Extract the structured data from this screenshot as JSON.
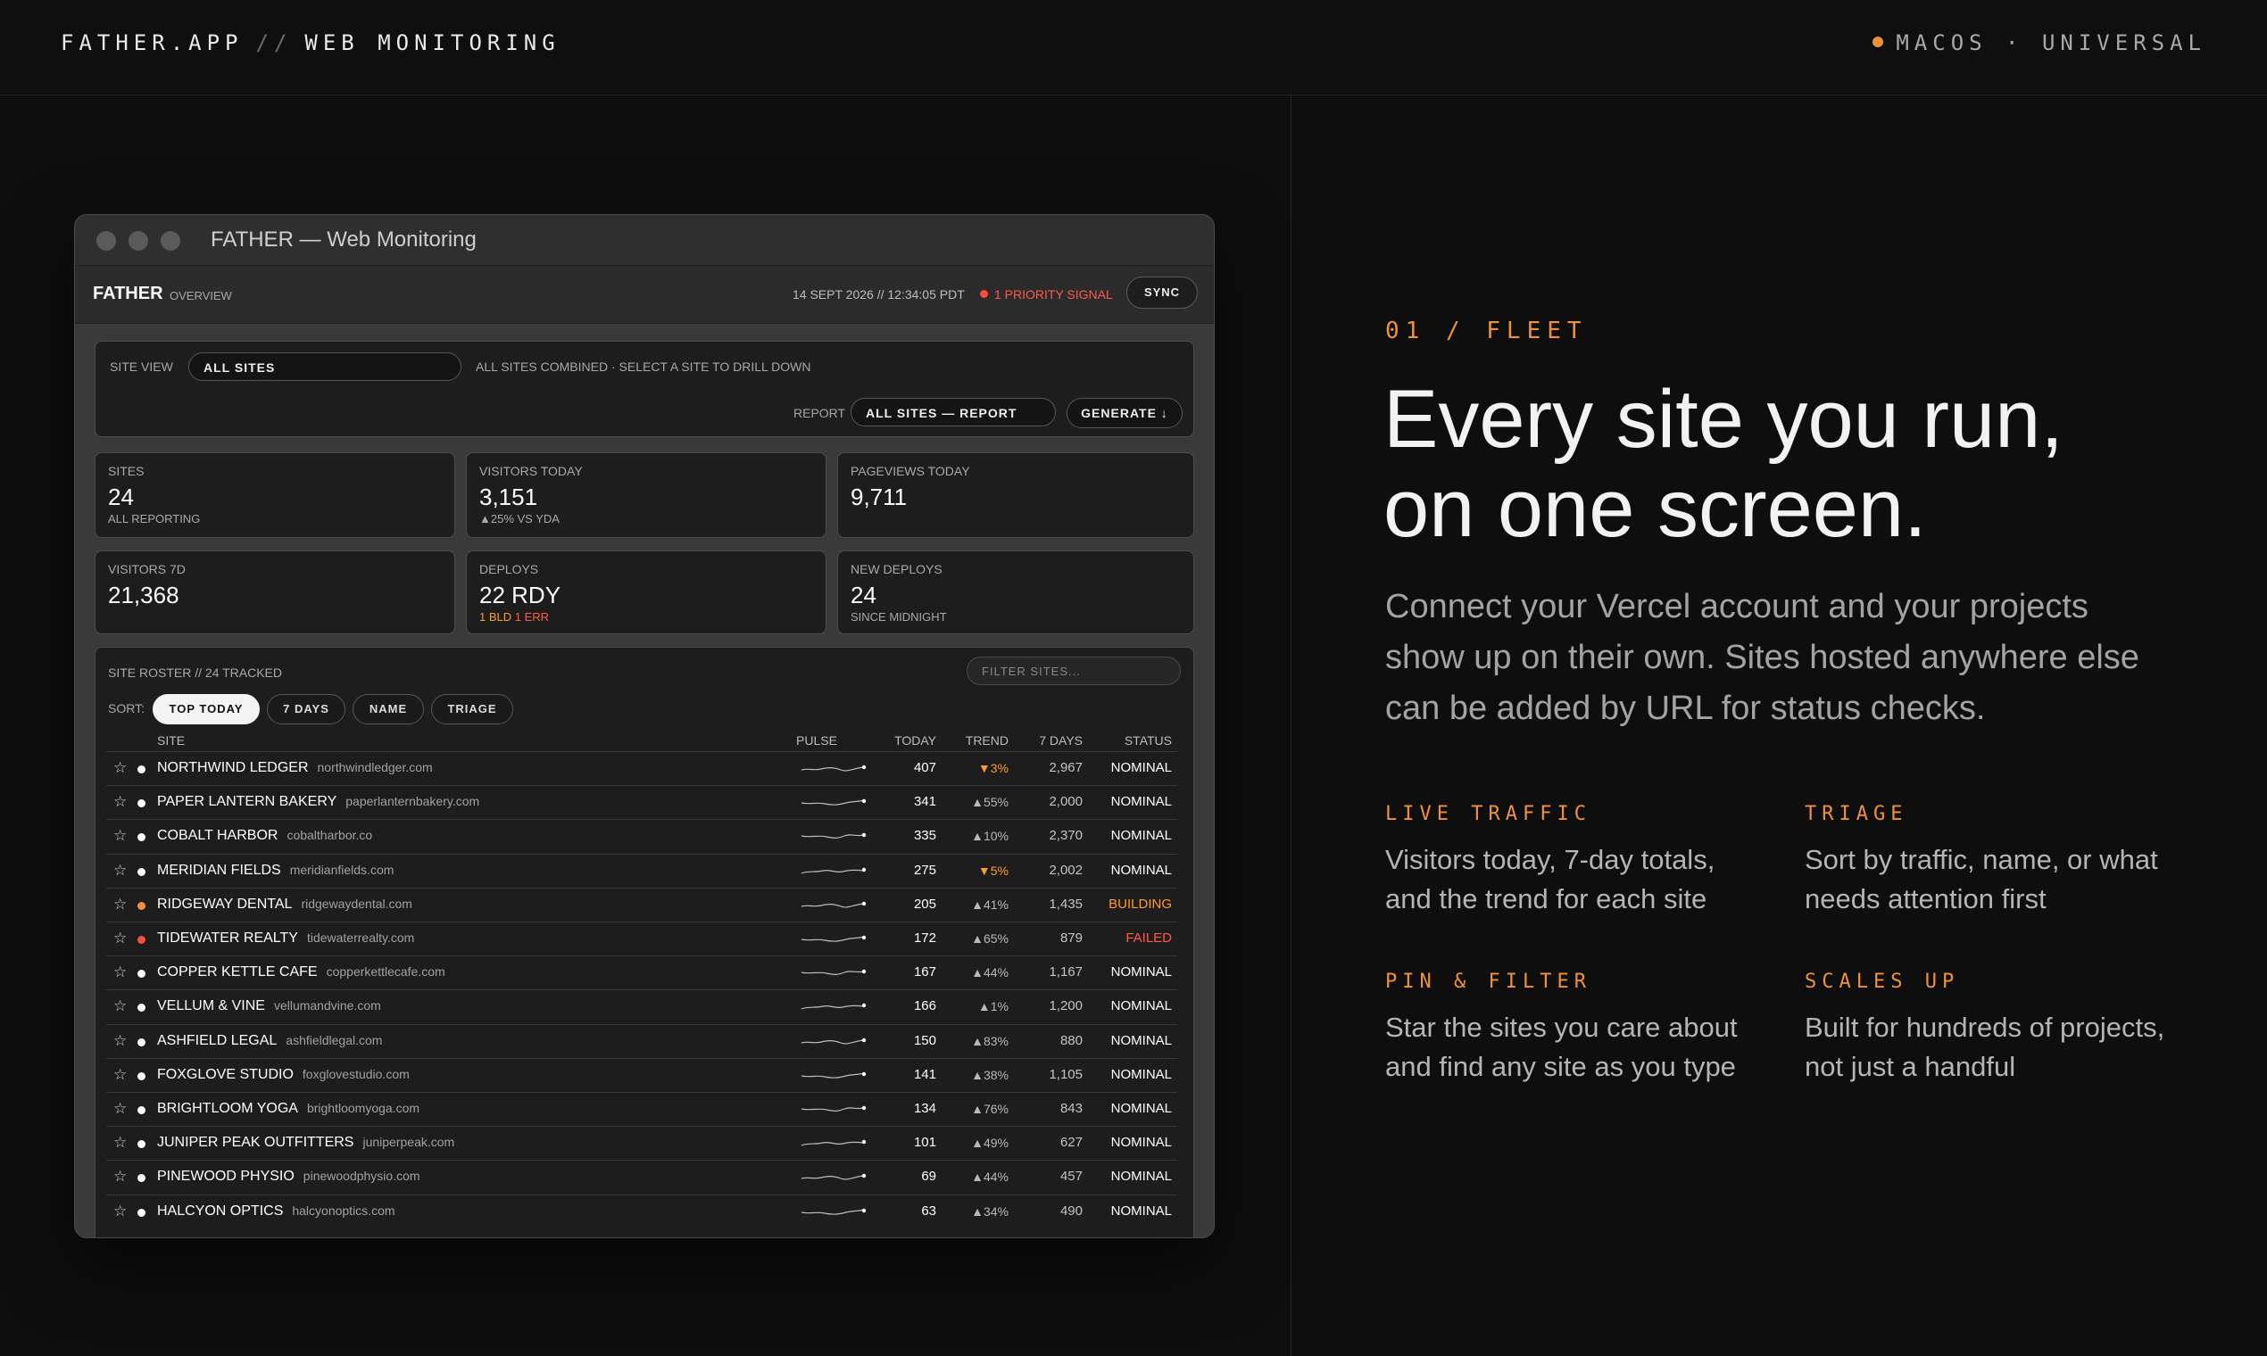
{
  "header": {
    "brand": "FATHER.APP",
    "brand_sep": "//",
    "brand_sub": "WEB MONITORING",
    "platform": "MACOS · UNIVERSAL"
  },
  "window": {
    "title": "FATHER — Web Monitoring",
    "app_name": "FATHER",
    "app_section": "OVERVIEW",
    "timestamp": "14 SEPT 2026 // 12:34:05 PDT",
    "priority_signal": "1 PRIORITY SIGNAL",
    "sync_label": "SYNC",
    "site_view": {
      "label": "SITE VIEW",
      "selected": "ALL SITES",
      "hint": "ALL SITES COMBINED · SELECT A SITE TO DRILL DOWN"
    },
    "report": {
      "label": "REPORT",
      "selected": "ALL SITES — REPORT",
      "generate_label": "GENERATE ↓"
    },
    "kpis": [
      {
        "label": "SITES",
        "value": "24",
        "sub": "ALL REPORTING"
      },
      {
        "label": "VISITORS TODAY",
        "value": "3,151",
        "sub": "▲25% VS YDA"
      },
      {
        "label": "PAGEVIEWS TODAY",
        "value": "9,711",
        "sub": ""
      },
      {
        "label": "VISITORS 7D",
        "value": "21,368",
        "sub": ""
      },
      {
        "label": "DEPLOYS",
        "value": "22 RDY",
        "sub_bld": "1 BLD",
        "sub_err": "1 ERR"
      },
      {
        "label": "NEW DEPLOYS",
        "value": "24",
        "sub": "SINCE MIDNIGHT"
      }
    ],
    "roster": {
      "title": "SITE ROSTER // 24 TRACKED",
      "filter_placeholder": "FILTER SITES...",
      "sort_label": "SORT:",
      "sort_options": [
        "TOP TODAY",
        "7 DAYS",
        "NAME",
        "TRIAGE"
      ],
      "active_sort": "TOP TODAY",
      "columns": {
        "site": "SITE",
        "pulse": "PULSE",
        "today": "TODAY",
        "trend": "TREND",
        "seven_days": "7 DAYS",
        "status": "STATUS"
      },
      "rows": [
        {
          "name": "NORTHWIND LEDGER",
          "domain": "northwindledger.com",
          "today": "407",
          "trend": "▼3%",
          "trend_dir": "down",
          "seven_days": "2,967",
          "status": "NOMINAL",
          "dot": "#ffffff",
          "status_color": "#ffffff"
        },
        {
          "name": "PAPER LANTERN BAKERY",
          "domain": "paperlanternbakery.com",
          "today": "341",
          "trend": "▲55%",
          "trend_dir": "up",
          "seven_days": "2,000",
          "status": "NOMINAL",
          "dot": "#ffffff",
          "status_color": "#ffffff"
        },
        {
          "name": "COBALT HARBOR",
          "domain": "cobaltharbor.co",
          "today": "335",
          "trend": "▲10%",
          "trend_dir": "up",
          "seven_days": "2,370",
          "status": "NOMINAL",
          "dot": "#ffffff",
          "status_color": "#ffffff"
        },
        {
          "name": "MERIDIAN FIELDS",
          "domain": "meridianfields.com",
          "today": "275",
          "trend": "▼5%",
          "trend_dir": "down",
          "seven_days": "2,002",
          "status": "NOMINAL",
          "dot": "#ffffff",
          "status_color": "#ffffff"
        },
        {
          "name": "RIDGEWAY DENTAL",
          "domain": "ridgewaydental.com",
          "today": "205",
          "trend": "▲41%",
          "trend_dir": "up",
          "seven_days": "1,435",
          "status": "BUILDING",
          "dot": "#f0913a",
          "status_color": "#ff9a2f"
        },
        {
          "name": "TIDEWATER REALTY",
          "domain": "tidewaterrealty.com",
          "today": "172",
          "trend": "▲65%",
          "trend_dir": "up",
          "seven_days": "879",
          "status": "FAILED",
          "dot": "#ff4b3a",
          "status_color": "#ff5a47"
        },
        {
          "name": "COPPER KETTLE CAFE",
          "domain": "copperkettlecafe.com",
          "today": "167",
          "trend": "▲44%",
          "trend_dir": "up",
          "seven_days": "1,167",
          "status": "NOMINAL",
          "dot": "#ffffff",
          "status_color": "#ffffff"
        },
        {
          "name": "VELLUM & VINE",
          "domain": "vellumandvine.com",
          "today": "166",
          "trend": "▲1%",
          "trend_dir": "up",
          "seven_days": "1,200",
          "status": "NOMINAL",
          "dot": "#ffffff",
          "status_color": "#ffffff"
        },
        {
          "name": "ASHFIELD LEGAL",
          "domain": "ashfieldlegal.com",
          "today": "150",
          "trend": "▲83%",
          "trend_dir": "up",
          "seven_days": "880",
          "status": "NOMINAL",
          "dot": "#ffffff",
          "status_color": "#ffffff"
        },
        {
          "name": "FOXGLOVE STUDIO",
          "domain": "foxglovestudio.com",
          "today": "141",
          "trend": "▲38%",
          "trend_dir": "up",
          "seven_days": "1,105",
          "status": "NOMINAL",
          "dot": "#ffffff",
          "status_color": "#ffffff"
        },
        {
          "name": "BRIGHTLOOM YOGA",
          "domain": "brightloomyoga.com",
          "today": "134",
          "trend": "▲76%",
          "trend_dir": "up",
          "seven_days": "843",
          "status": "NOMINAL",
          "dot": "#ffffff",
          "status_color": "#ffffff"
        },
        {
          "name": "JUNIPER PEAK OUTFITTERS",
          "domain": "juniperpeak.com",
          "today": "101",
          "trend": "▲49%",
          "trend_dir": "up",
          "seven_days": "627",
          "status": "NOMINAL",
          "dot": "#ffffff",
          "status_color": "#ffffff"
        },
        {
          "name": "PINEWOOD PHYSIO",
          "domain": "pinewoodphysio.com",
          "today": "69",
          "trend": "▲44%",
          "trend_dir": "up",
          "seven_days": "457",
          "status": "NOMINAL",
          "dot": "#ffffff",
          "status_color": "#ffffff"
        },
        {
          "name": "HALCYON OPTICS",
          "domain": "halcyonoptics.com",
          "today": "63",
          "trend": "▲34%",
          "trend_dir": "up",
          "seven_days": "490",
          "status": "NOMINAL",
          "dot": "#ffffff",
          "status_color": "#ffffff"
        }
      ]
    }
  },
  "marketing": {
    "eyebrow": "01 / FLEET",
    "headline_line1": "Every site you run,",
    "headline_line2": "on one screen.",
    "lede": "Connect your Vercel account and your projects show up on their own. Sites hosted anywhere else can be added by URL for status checks.",
    "features": [
      {
        "title": "LIVE TRAFFIC",
        "body": "Visitors today, 7-day totals, and the trend for each site"
      },
      {
        "title": "TRIAGE",
        "body": "Sort by traffic, name, or what needs attention first"
      },
      {
        "title": "PIN & FILTER",
        "body": "Star the sites you care about and find any site as you type"
      },
      {
        "title": "SCALES UP",
        "body": "Built for hundreds of projects, not just a handful"
      }
    ]
  },
  "colors": {
    "accent": "#f0913a",
    "alert": "#ff4b3a",
    "background": "#0e0e0e"
  }
}
